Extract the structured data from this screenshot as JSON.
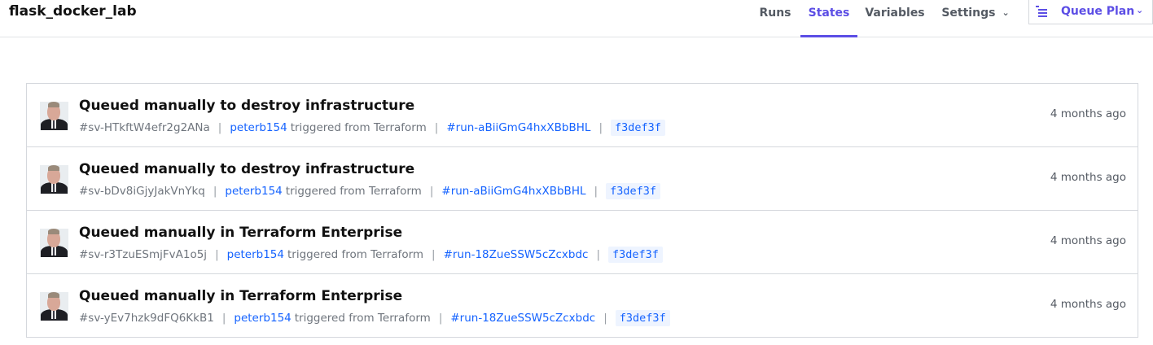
{
  "header": {
    "workspace_name": "flask_docker_lab",
    "nav": [
      {
        "label": "Runs"
      },
      {
        "label": "States"
      },
      {
        "label": "Variables"
      },
      {
        "label": "Settings"
      }
    ],
    "active_tab": "States",
    "queue_button_label": "Queue Plan",
    "accent_color": "#5c4ee5",
    "link_color": "#1563ff"
  },
  "states": [
    {
      "title": "Queued manually to destroy infrastructure",
      "id": "#sv-HTkftW4efr2g2ANa",
      "user": "peterb154",
      "trigger_text": "triggered from Terraform",
      "run_id": "#run-aBiiGmG4hxXBbBHL",
      "sha": "f3def3f",
      "age": "4 months ago"
    },
    {
      "title": "Queued manually to destroy infrastructure",
      "id": "#sv-bDv8iGjyJakVnYkq",
      "user": "peterb154",
      "trigger_text": "triggered from Terraform",
      "run_id": "#run-aBiiGmG4hxXBbBHL",
      "sha": "f3def3f",
      "age": "4 months ago"
    },
    {
      "title": "Queued manually in Terraform Enterprise",
      "id": "#sv-r3TzuESmjFvA1o5j",
      "user": "peterb154",
      "trigger_text": "triggered from Terraform",
      "run_id": "#run-18ZueSSW5cZcxbdc",
      "sha": "f3def3f",
      "age": "4 months ago"
    },
    {
      "title": "Queued manually in Terraform Enterprise",
      "id": "#sv-yEv7hzk9dFQ6KkB1",
      "user": "peterb154",
      "trigger_text": "triggered from Terraform",
      "run_id": "#run-18ZueSSW5cZcxbdc",
      "sha": "f3def3f",
      "age": "4 months ago"
    }
  ]
}
